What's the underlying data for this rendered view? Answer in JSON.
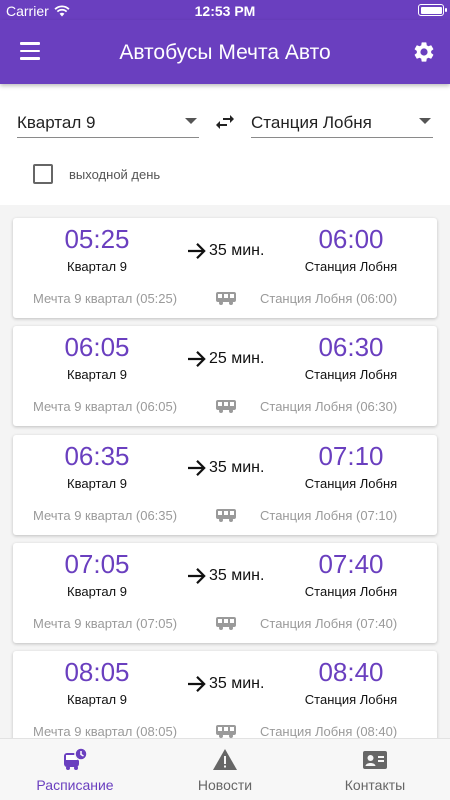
{
  "status_bar": {
    "carrier": "Carrier",
    "time": "12:53 PM"
  },
  "app_bar": {
    "title": "Автобусы Мечта Авто",
    "menu_icon": "menu-icon",
    "settings_icon": "gear-icon"
  },
  "filters": {
    "from_stop": "Квартал 9",
    "to_stop": "Станция Лобня",
    "weekend_label": "выходной день",
    "weekend_checked": false
  },
  "trips": [
    {
      "departure_time": "05:25",
      "departure_stop": "Квартал 9",
      "duration": "35 мин.",
      "arrival_time": "06:00",
      "arrival_stop": "Станция Лобня",
      "route_from": "Мечта 9 квартал (05:25)",
      "route_to": "Станция Лобня (06:00)"
    },
    {
      "departure_time": "06:05",
      "departure_stop": "Квартал 9",
      "duration": "25 мин.",
      "arrival_time": "06:30",
      "arrival_stop": "Станция Лобня",
      "route_from": "Мечта 9 квартал (06:05)",
      "route_to": "Станция Лобня (06:30)"
    },
    {
      "departure_time": "06:35",
      "departure_stop": "Квартал 9",
      "duration": "35 мин.",
      "arrival_time": "07:10",
      "arrival_stop": "Станция Лобня",
      "route_from": "Мечта 9 квартал (06:35)",
      "route_to": "Станция Лобня (07:10)"
    },
    {
      "departure_time": "07:05",
      "departure_stop": "Квартал 9",
      "duration": "35 мин.",
      "arrival_time": "07:40",
      "arrival_stop": "Станция Лобня",
      "route_from": "Мечта 9 квартал (07:05)",
      "route_to": "Станция Лобня (07:40)"
    },
    {
      "departure_time": "08:05",
      "departure_stop": "Квартал 9",
      "duration": "35 мин.",
      "arrival_time": "08:40",
      "arrival_stop": "Станция Лобня",
      "route_from": "Мечта 9 квартал (08:05)",
      "route_to": "Станция Лобня (08:40)"
    }
  ],
  "tab_bar": {
    "tabs": [
      {
        "label": "Расписание",
        "icon": "bus-schedule-icon",
        "active": true
      },
      {
        "label": "Новости",
        "icon": "warning-icon",
        "active": false
      },
      {
        "label": "Контакты",
        "icon": "contacts-icon",
        "active": false
      }
    ]
  },
  "colors": {
    "primary": "#6a3fbf",
    "muted": "#9a9a9a",
    "inactive_tab": "#666666"
  }
}
